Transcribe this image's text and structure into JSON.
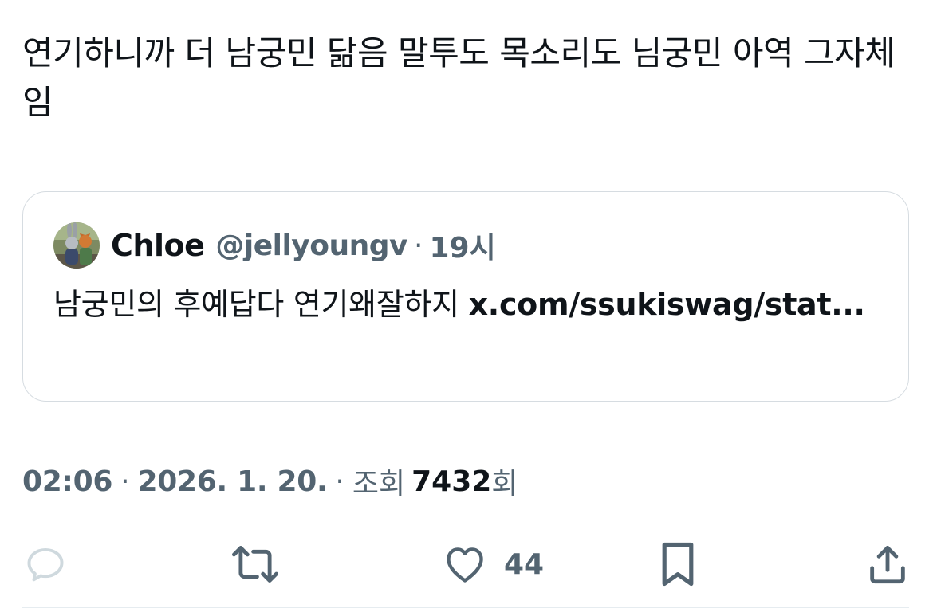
{
  "tweet": {
    "text": "연기하니까 더 남궁민 닮음 말투도 목소리도 님궁민 아역 그자체임"
  },
  "quote": {
    "author_name": "Chloe",
    "handle": "@jellyoungv",
    "separator": "·",
    "time_ago": "19시",
    "body_text": "남궁민의 후예답다 연기왜잘하지 ",
    "link_text": "x.com/ssukiswag/stat..."
  },
  "meta": {
    "time": "02:06",
    "separator": "·",
    "date": "2026. 1. 20.",
    "views_label": "조회",
    "views_count": "7432",
    "views_unit": "회"
  },
  "actions": {
    "reply_icon": "speech-bubble-icon",
    "retweet_icon": "repost-icon",
    "like_icon": "heart-icon",
    "like_count": "44",
    "bookmark_icon": "bookmark-icon",
    "share_icon": "share-icon"
  },
  "colors": {
    "text_primary": "#0f1419",
    "text_secondary": "#536471",
    "border": "#d6dce1",
    "reply_icon_faded": "#cfd9de"
  }
}
